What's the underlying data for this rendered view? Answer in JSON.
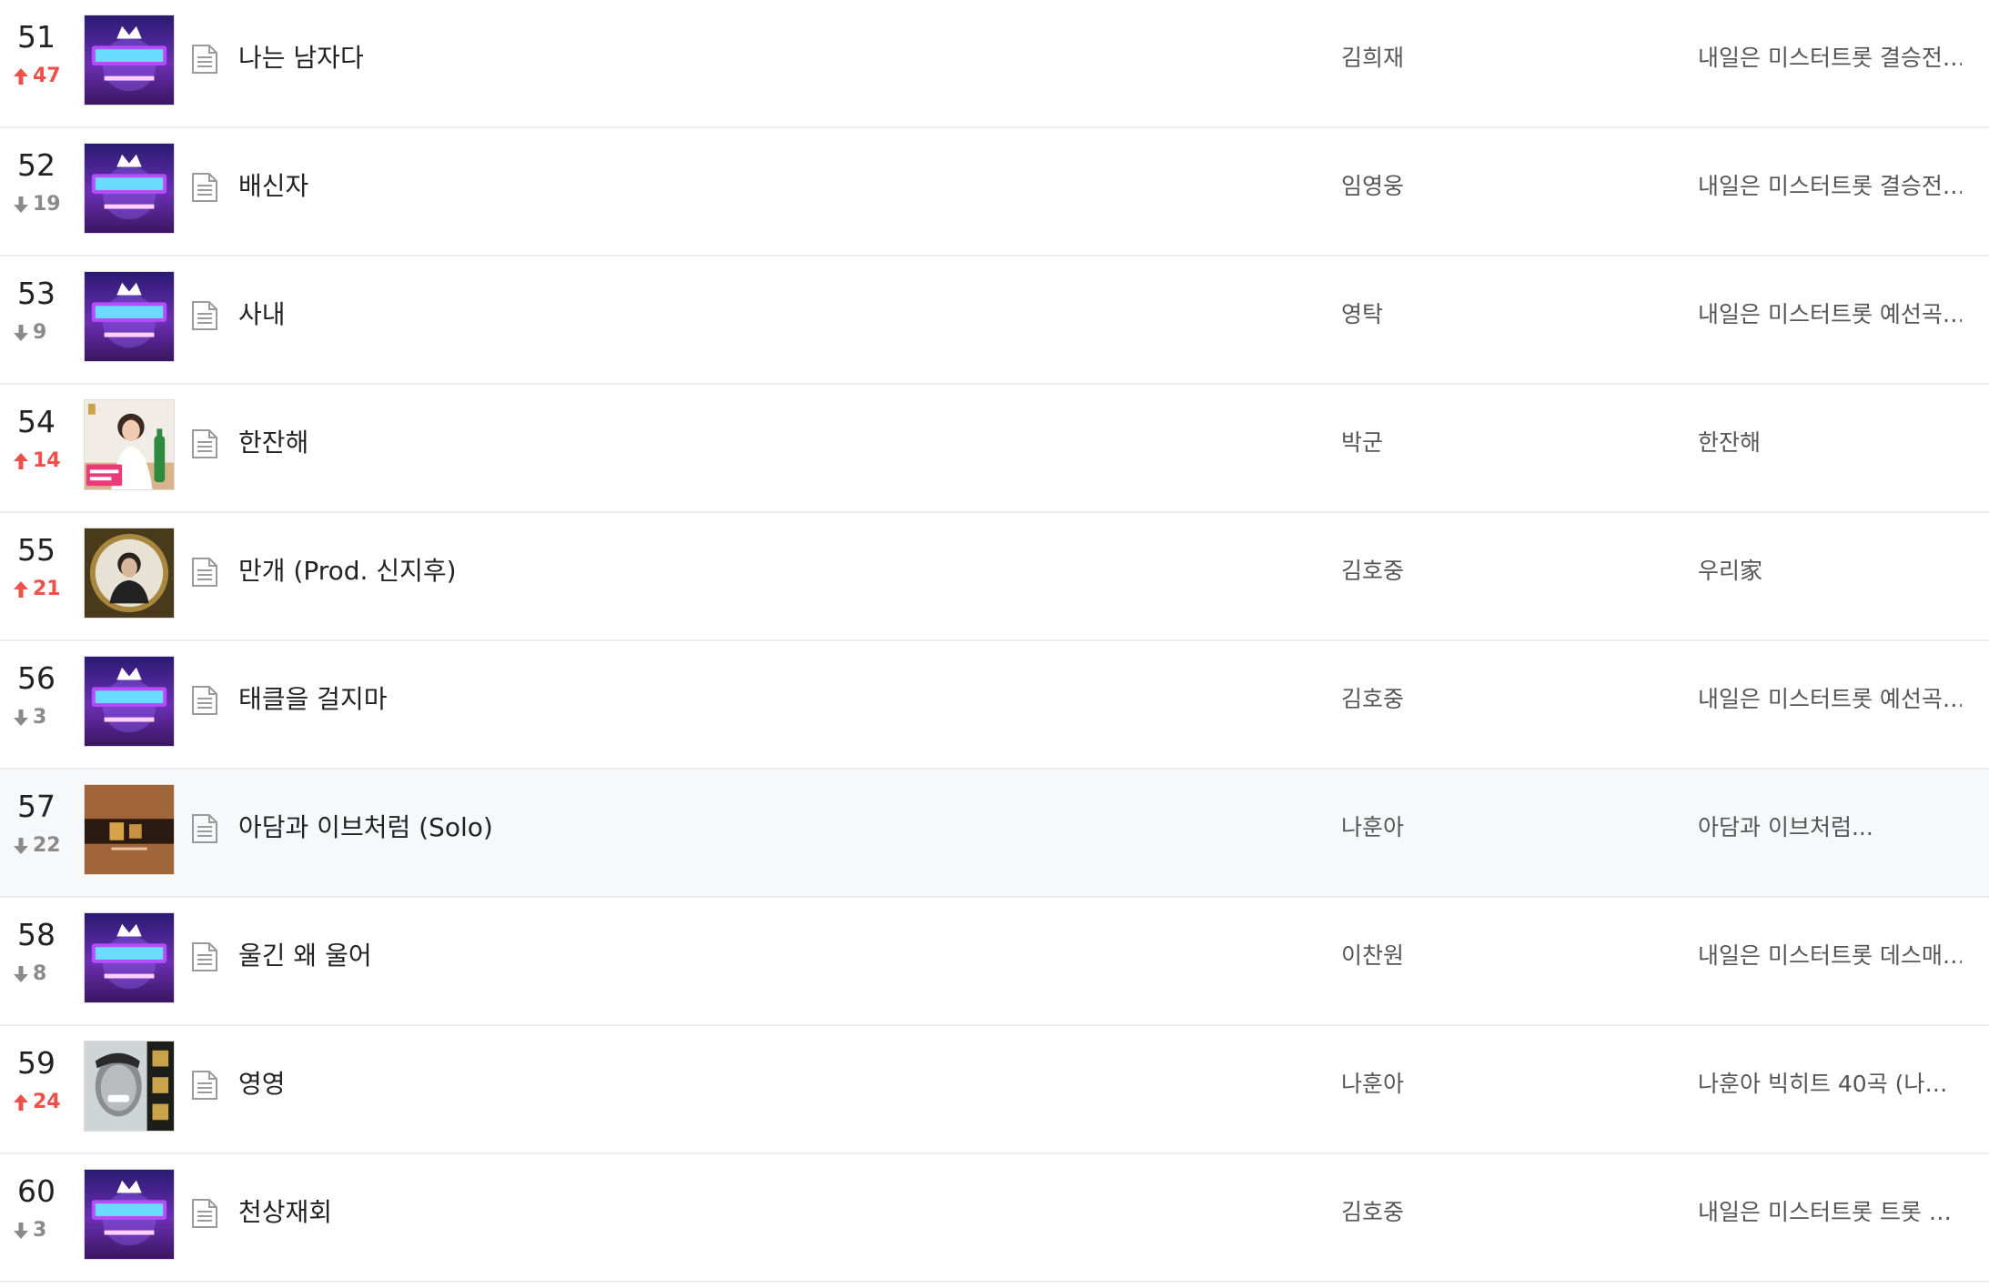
{
  "colors": {
    "rank_up": "#f1504a",
    "rank_down": "#8a8a8a",
    "highlight_row": "#f7f8fa",
    "divider": "#ececec"
  },
  "songs": [
    {
      "rank": "51",
      "change": "47",
      "direction": "up",
      "cover": "misstrot-purple",
      "title": "나는 남자다",
      "artist": "김희재",
      "album": "내일은 미스터트롯 결승전…"
    },
    {
      "rank": "52",
      "change": "19",
      "direction": "down",
      "cover": "misstrot-purple",
      "title": "배신자",
      "artist": "임영웅",
      "album": "내일은 미스터트롯 결승전…"
    },
    {
      "rank": "53",
      "change": "9",
      "direction": "down",
      "cover": "misstrot-purple",
      "title": "사내",
      "artist": "영탁",
      "album": "내일은 미스터트롯 예선곡…"
    },
    {
      "rank": "54",
      "change": "14",
      "direction": "up",
      "cover": "woman-soju",
      "title": "한잔해",
      "artist": "박군",
      "album": "한잔해"
    },
    {
      "rank": "55",
      "change": "21",
      "direction": "up",
      "cover": "round-portrait",
      "title": "만개 (Prod. 신지후)",
      "artist": "김호중",
      "album": "우리家"
    },
    {
      "rank": "56",
      "change": "3",
      "direction": "down",
      "cover": "misstrot-purple",
      "title": "태클을 걸지마",
      "artist": "김호중",
      "album": "내일은 미스터트롯 예선곡…"
    },
    {
      "rank": "57",
      "change": "22",
      "direction": "down",
      "cover": "brown-banner",
      "title": "아담과 이브처럼 (Solo)",
      "artist": "나훈아",
      "album": "아담과 이브처럼..."
    },
    {
      "rank": "58",
      "change": "8",
      "direction": "down",
      "cover": "misstrot-purple",
      "title": "울긴 왜 울어",
      "artist": "이찬원",
      "album": "내일은 미스터트롯 데스매…"
    },
    {
      "rank": "59",
      "change": "24",
      "direction": "up",
      "cover": "bw-portrait-gold",
      "title": "영영",
      "artist": "나훈아",
      "album": "나훈아 빅히트 40곡 (나…"
    },
    {
      "rank": "60",
      "change": "3",
      "direction": "down",
      "cover": "misstrot-purple",
      "title": "천상재회",
      "artist": "김호중",
      "album": "내일은 미스터트롯 트롯 …"
    }
  ]
}
